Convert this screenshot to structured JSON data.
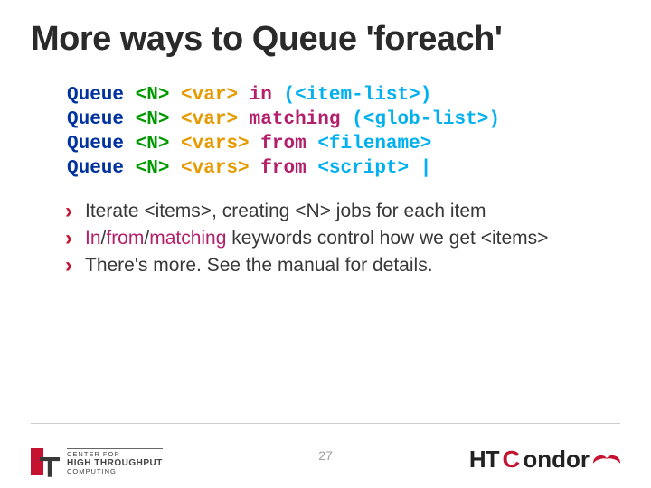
{
  "title": "More ways to Queue 'foreach'",
  "code": {
    "l1": {
      "cmd": "Queue",
      "n": "<N>",
      "var": "<var>",
      "kw": "in",
      "arg": "(<item-list>)"
    },
    "l2": {
      "cmd": "Queue",
      "n": "<N>",
      "var": "<var>",
      "kw": "matching",
      "arg": "(<glob-list>)"
    },
    "l3": {
      "cmd": "Queue",
      "n": "<N>",
      "var": "<vars>",
      "kw": "from",
      "arg": "<filename>"
    },
    "l4": {
      "cmd": "Queue",
      "n": "<N>",
      "var": "<vars>",
      "kw": "from",
      "arg": "<script> |"
    }
  },
  "bullets": {
    "b1": {
      "t1": "Iterate <items>, creating <N> jobs for each item"
    },
    "b2": {
      "kw_in": "In",
      "sep1": "/",
      "kw_from": "from",
      "sep2": "/",
      "kw_match": "matching",
      "rest": " keywords control how we get <items>"
    },
    "b3": {
      "t1": "There's more. See the manual for details."
    }
  },
  "footer": {
    "page": "27",
    "left_logo": {
      "line1": "CENTER FOR",
      "line2": "HIGH THROUGHPUT",
      "line3": "COMPUTING"
    },
    "right_logo": {
      "ht": "HT",
      "c": "C",
      "ondor": "ondor"
    }
  }
}
